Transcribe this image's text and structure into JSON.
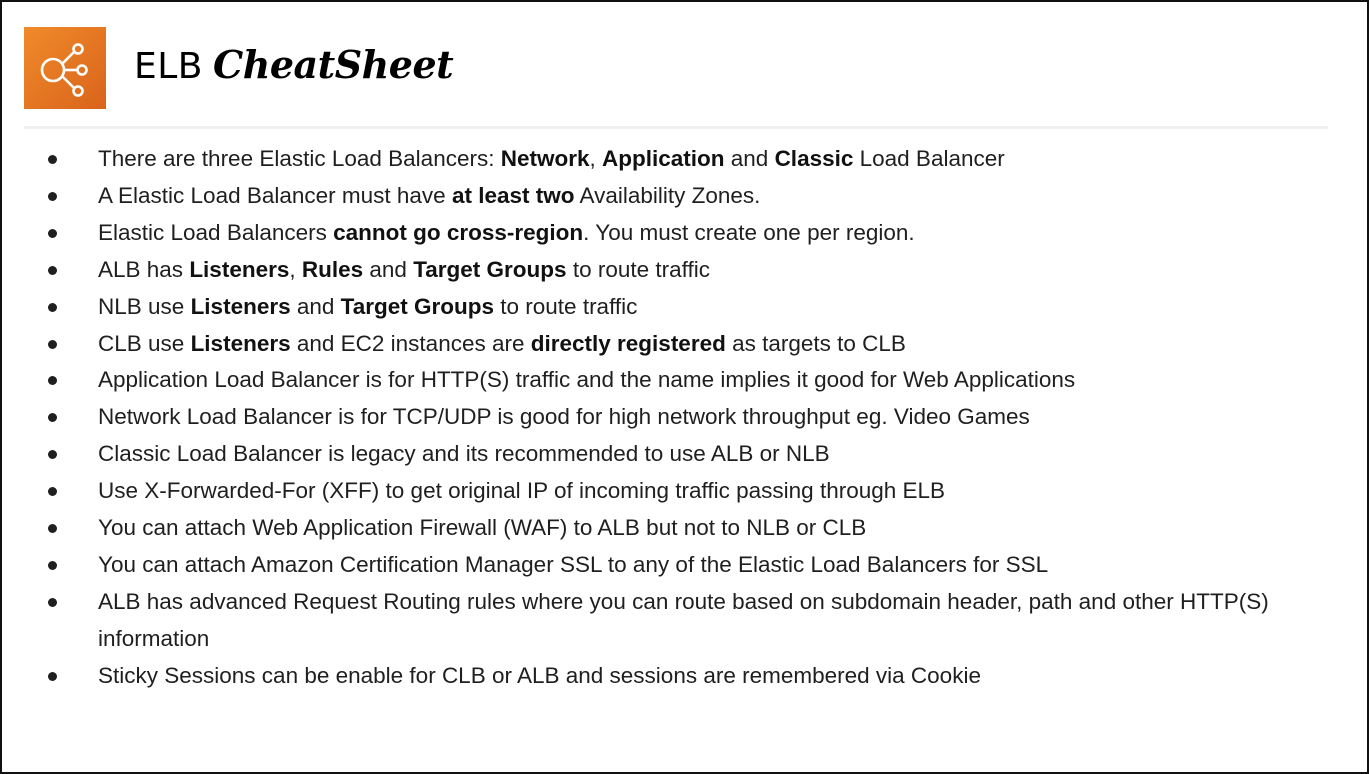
{
  "slide": {
    "title_main": "ELB",
    "title_script": "CheatSheet",
    "logo_icon": "elb-share-nodes-icon",
    "logo_color": "#e8772a",
    "bullets": [
      {
        "segments": [
          {
            "text": "There are three Elastic Load Balancers: ",
            "bold": false
          },
          {
            "text": "Network",
            "bold": true
          },
          {
            "text": ", ",
            "bold": false
          },
          {
            "text": "Application",
            "bold": true
          },
          {
            "text": " and ",
            "bold": false
          },
          {
            "text": "Classic",
            "bold": true
          },
          {
            "text": " Load Balancer",
            "bold": false
          }
        ]
      },
      {
        "segments": [
          {
            "text": "A Elastic Load Balancer must have ",
            "bold": false
          },
          {
            "text": "at least two",
            "bold": true
          },
          {
            "text": " Availability Zones.",
            "bold": false
          }
        ]
      },
      {
        "segments": [
          {
            "text": "Elastic Load Balancers ",
            "bold": false
          },
          {
            "text": "cannot go cross-region",
            "bold": true
          },
          {
            "text": ". You must create one per region.",
            "bold": false
          }
        ]
      },
      {
        "segments": [
          {
            "text": "ALB has ",
            "bold": false
          },
          {
            "text": "Listeners",
            "bold": true
          },
          {
            "text": ", ",
            "bold": false
          },
          {
            "text": "Rules",
            "bold": true
          },
          {
            "text": " and ",
            "bold": false
          },
          {
            "text": "Target Groups",
            "bold": true
          },
          {
            "text": " to route traffic",
            "bold": false
          }
        ]
      },
      {
        "segments": [
          {
            "text": "NLB use ",
            "bold": false
          },
          {
            "text": "Listeners",
            "bold": true
          },
          {
            "text": " and ",
            "bold": false
          },
          {
            "text": "Target Groups",
            "bold": true
          },
          {
            "text": " to route traffic",
            "bold": false
          }
        ]
      },
      {
        "segments": [
          {
            "text": "CLB use ",
            "bold": false
          },
          {
            "text": "Listeners",
            "bold": true
          },
          {
            "text": " and EC2 instances are ",
            "bold": false
          },
          {
            "text": "directly registered",
            "bold": true
          },
          {
            "text": " as targets to CLB",
            "bold": false
          }
        ]
      },
      {
        "segments": [
          {
            "text": "Application Load Balancer is for HTTP(S) traffic and the name implies it good for Web Applications",
            "bold": false
          }
        ]
      },
      {
        "segments": [
          {
            "text": "Network Load Balancer is for TCP/UDP is good for high network throughput eg. Video Games",
            "bold": false
          }
        ]
      },
      {
        "segments": [
          {
            "text": "Classic Load Balancer is legacy and its recommended to use ALB or NLB",
            "bold": false
          }
        ]
      },
      {
        "segments": [
          {
            "text": "Use X-Forwarded-For (XFF) to get original IP of incoming traffic passing through ELB",
            "bold": false
          }
        ]
      },
      {
        "segments": [
          {
            "text": "You can attach Web Application Firewall (WAF) to ALB but not to NLB or CLB",
            "bold": false
          }
        ]
      },
      {
        "segments": [
          {
            "text": "You can attach Amazon Certification Manager SSL to any of the Elastic Load Balancers for SSL",
            "bold": false
          }
        ]
      },
      {
        "wrap": true,
        "segments": [
          {
            "text": "ALB has advanced Request Routing rules where you can route based on subdomain header, path and other HTTP(S) information",
            "bold": false
          }
        ]
      },
      {
        "segments": [
          {
            "text": "Sticky Sessions can be enable for CLB or ALB and sessions are remembered via Cookie",
            "bold": false
          }
        ]
      }
    ]
  }
}
